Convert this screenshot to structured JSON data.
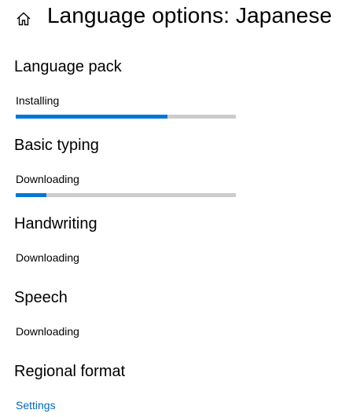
{
  "header": {
    "home_icon": "home-icon",
    "title": "Language options: Japanese"
  },
  "sections": {
    "language_pack": {
      "title": "Language pack",
      "status": "Installing",
      "progress": 0.69
    },
    "basic_typing": {
      "title": "Basic typing",
      "status": "Downloading",
      "progress": 0.14
    },
    "handwriting": {
      "title": "Handwriting",
      "status": "Downloading"
    },
    "speech": {
      "title": "Speech",
      "status": "Downloading"
    },
    "regional_format": {
      "title": "Regional format",
      "link": "Settings"
    }
  },
  "colors": {
    "accent": "#0078d7",
    "track": "#cccccc",
    "link": "#0067c0"
  }
}
